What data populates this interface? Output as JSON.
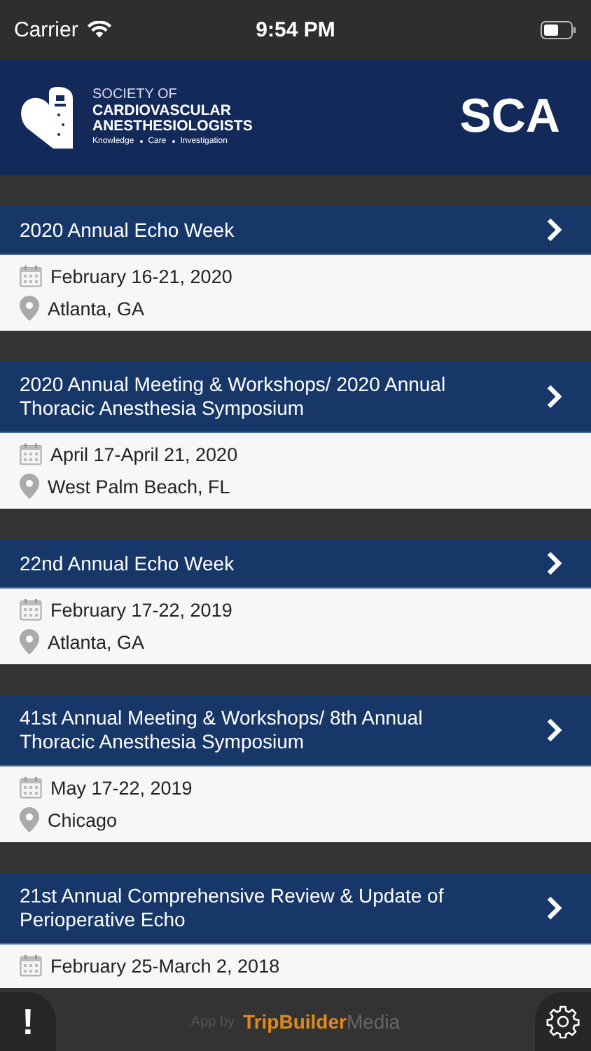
{
  "status_bar": {
    "carrier": "Carrier",
    "time": "9:54 PM"
  },
  "header": {
    "logo": {
      "line1": "SOCIETY OF",
      "line2": "CARDIOVASCULAR",
      "line3": "ANESTHESIOLOGISTS",
      "tagline": [
        "Knowledge",
        "Care",
        "Investigation"
      ]
    },
    "title": "SCA"
  },
  "events": [
    {
      "title": "2020 Annual Echo Week",
      "date": "February 16-21, 2020",
      "location": "Atlanta, GA"
    },
    {
      "title": "2020 Annual Meeting & Workshops/ 2020 Annual Thoracic Anesthesia Symposium",
      "date": "April 17-April 21, 2020",
      "location": "West Palm Beach, FL"
    },
    {
      "title": "22nd Annual Echo Week",
      "date": "February 17-22, 2019",
      "location": "Atlanta, GA"
    },
    {
      "title": "41st Annual Meeting & Workshops/ 8th Annual Thoracic Anesthesia Symposium",
      "date": "May 17-22, 2019",
      "location": "Chicago"
    },
    {
      "title": "21st Annual Comprehensive Review & Update of Perioperative Echo",
      "date": "February 25-March 2, 2018"
    }
  ],
  "footer": {
    "credit": "App by",
    "brand_primary": "TripBuilder",
    "brand_secondary": "Media",
    "alert": "!"
  }
}
